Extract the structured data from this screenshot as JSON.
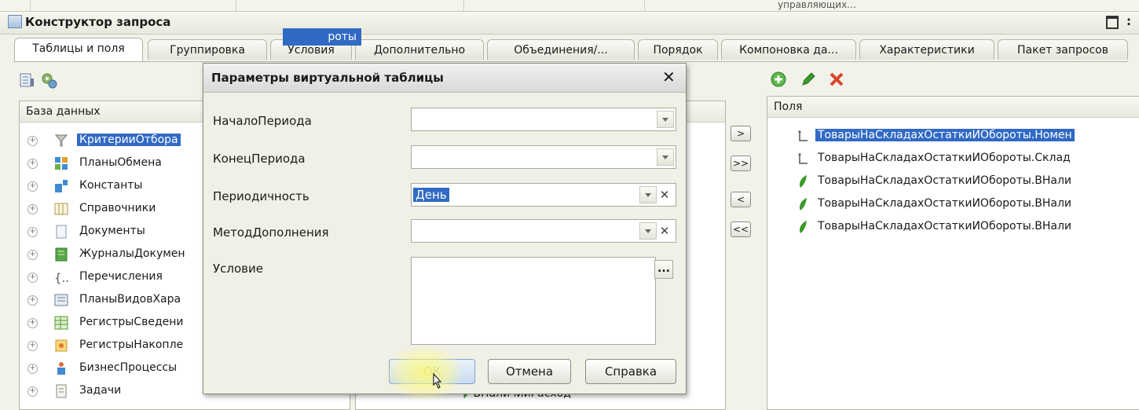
{
  "top_strip": {
    "cut_text": "управляющих..."
  },
  "window": {
    "title": "Конструктор запроса"
  },
  "tabs": [
    {
      "label": "Таблицы и поля",
      "active": true
    },
    {
      "label": "Группировка"
    },
    {
      "label": "Условия"
    },
    {
      "label": "Дополнительно"
    },
    {
      "label": "Объединения/..."
    },
    {
      "label": "Порядок"
    },
    {
      "label": "Компоновка да..."
    },
    {
      "label": "Характеристики"
    },
    {
      "label": "Пакет запросов"
    }
  ],
  "left_panel": {
    "header": "База данных",
    "items": [
      {
        "label": "КритерииОтбора",
        "icon": "filter-icon",
        "selected": true
      },
      {
        "label": "ПланыОбмена",
        "icon": "exchange-icon"
      },
      {
        "label": "Константы",
        "icon": "constants-icon"
      },
      {
        "label": "Справочники",
        "icon": "catalog-icon"
      },
      {
        "label": "Документы",
        "icon": "document-icon"
      },
      {
        "label": "ЖурналыДокумен",
        "icon": "journal-icon"
      },
      {
        "label": "Перечисления",
        "icon": "enum-icon"
      },
      {
        "label": "ПланыВидовХара",
        "icon": "chart-types-icon"
      },
      {
        "label": "РегистрыСведени",
        "icon": "info-register-icon"
      },
      {
        "label": "РегистрыНакопле",
        "icon": "accum-register-icon"
      },
      {
        "label": "БизнесПроцессы",
        "icon": "business-process-icon"
      },
      {
        "label": "Задачи",
        "icon": "task-icon"
      }
    ]
  },
  "middle_panel": {
    "selected_cut": "роты",
    "cut_k": "к",
    "bottom_cut": "ВНаличииРасход"
  },
  "arrows": [
    ">",
    ">>",
    "<",
    "<<"
  ],
  "right_panel": {
    "header": "Поля",
    "items": [
      {
        "label": "ТоварыНаСкладахОстаткиИОбороты.Номен",
        "icon": "dimension-icon",
        "selected": true
      },
      {
        "label": "ТоварыНаСкладахОстаткиИОбороты.Склад",
        "icon": "dimension-icon"
      },
      {
        "label": "ТоварыНаСкладахОстаткиИОбороты.ВНали",
        "icon": "resource-icon"
      },
      {
        "label": "ТоварыНаСкладахОстаткиИОбороты.ВНали",
        "icon": "resource-icon"
      },
      {
        "label": "ТоварыНаСкладахОстаткиИОбороты.ВНали",
        "icon": "resource-icon"
      }
    ]
  },
  "dialog": {
    "title": "Параметры виртуальной таблицы",
    "close": "✕",
    "fields": [
      {
        "label": "НачалоПериода",
        "value": ""
      },
      {
        "label": "КонецПериода",
        "value": ""
      },
      {
        "label": "Периодичность",
        "value": "День"
      },
      {
        "label": "МетодДополнения",
        "value": ""
      },
      {
        "label": "Условие",
        "value": ""
      }
    ],
    "more_button": "...",
    "buttons": {
      "ok": "ОК",
      "cancel": "Отмена",
      "help": "Справка"
    }
  },
  "colors": {
    "selection": "#316ac5",
    "accent_green": "#3a9a2a",
    "delete_red": "#d9442a"
  }
}
